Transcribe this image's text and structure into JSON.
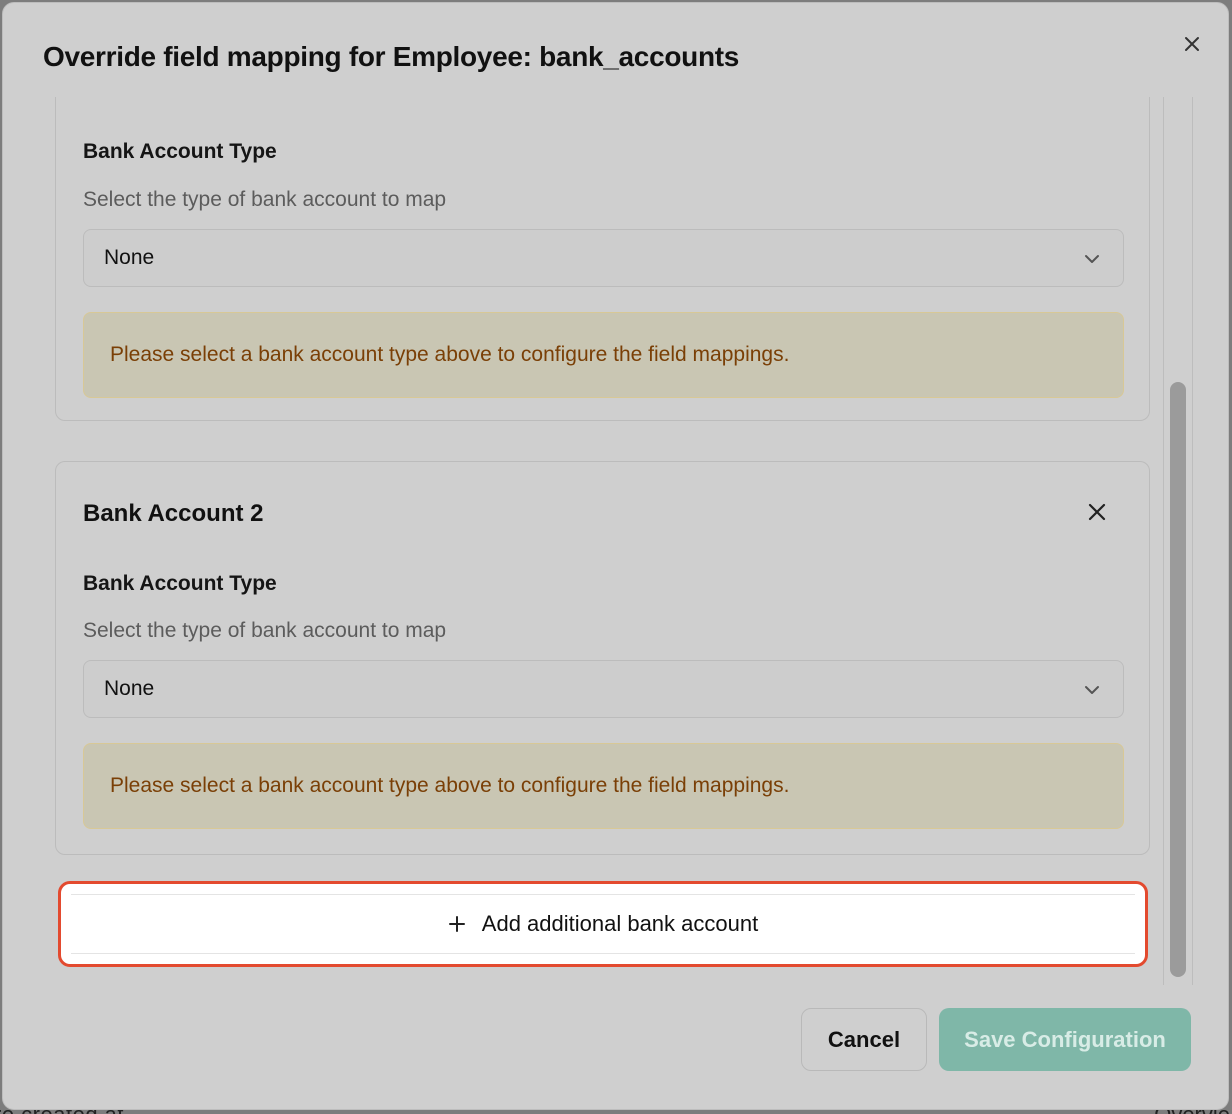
{
  "background": {
    "left_text": "re created at",
    "right_text": "Overvie"
  },
  "modal": {
    "title": "Override field mapping for Employee: bank_accounts",
    "close_icon": "close-icon"
  },
  "bank_accounts": [
    {
      "title": "",
      "field_label": "Bank Account Type",
      "field_description": "Select the type of bank account to map",
      "selected_value": "None",
      "notice": "Please select a bank account type above to configure the field mappings."
    },
    {
      "title": "Bank Account 2",
      "field_label": "Bank Account Type",
      "field_description": "Select the type of bank account to map",
      "selected_value": "None",
      "notice": "Please select a bank account type above to configure the field mappings."
    }
  ],
  "add_button": {
    "label": "Add additional bank account",
    "icon": "plus-icon"
  },
  "footer": {
    "cancel_label": "Cancel",
    "save_label": "Save Configuration"
  },
  "colors": {
    "highlight_border": "#e34a2f",
    "save_button": "#7fb7a8",
    "notice_text": "#7a3f06"
  }
}
